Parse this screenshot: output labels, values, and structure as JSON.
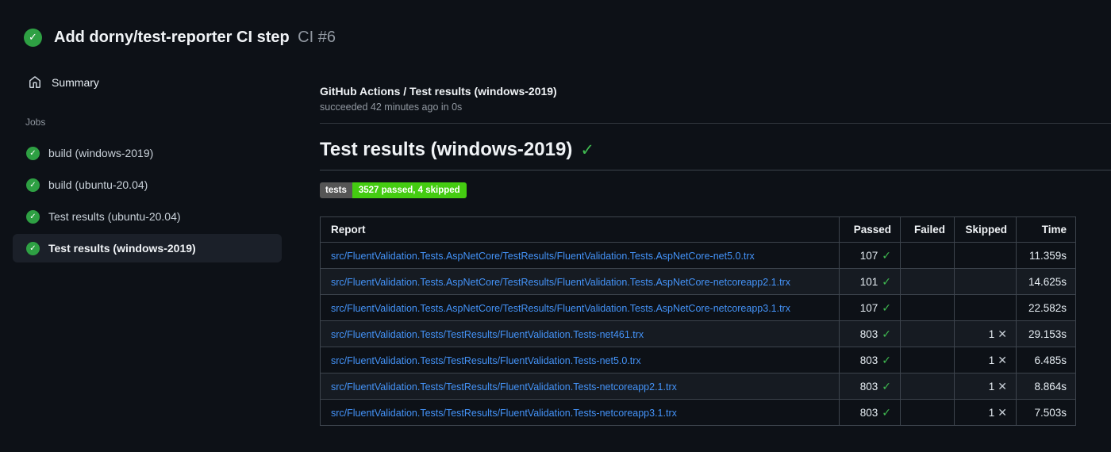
{
  "icons": {
    "check": "✓",
    "cross": "✕"
  },
  "colors": {
    "page_bg": "#0d1117",
    "row_alt_bg": "#161b22",
    "selected_item_bg": "#1b2029",
    "accent_green": "#2ea043",
    "check_green": "#3fb950",
    "link_blue": "#4493f8",
    "badge_gray": "#555555",
    "badge_green": "#44cc11",
    "border_gray": "#3d444d"
  },
  "header": {
    "title": "Add dorny/test-reporter CI step",
    "run_number": "CI #6"
  },
  "sidebar": {
    "summary_label": "Summary",
    "jobs_label": "Jobs",
    "jobs": [
      {
        "label": "build (windows-2019)",
        "selected": false
      },
      {
        "label": "build (ubuntu-20.04)",
        "selected": false
      },
      {
        "label": "Test results (ubuntu-20.04)",
        "selected": false
      },
      {
        "label": "Test results (windows-2019)",
        "selected": true
      }
    ]
  },
  "main": {
    "breadcrumb": "GitHub Actions / Test results (windows-2019)",
    "status_line": "succeeded 42 minutes ago in 0s",
    "heading": "Test results (windows-2019)",
    "badge": {
      "label": "tests",
      "value": "3527 passed, 4 skipped"
    },
    "table": {
      "columns": [
        {
          "key": "report",
          "label": "Report"
        },
        {
          "key": "passed",
          "label": "Passed"
        },
        {
          "key": "failed",
          "label": "Failed"
        },
        {
          "key": "skipped",
          "label": "Skipped"
        },
        {
          "key": "time",
          "label": "Time"
        }
      ],
      "rows": [
        {
          "report": "src/FluentValidation.Tests.AspNetCore/TestResults/FluentValidation.Tests.AspNetCore-net5.0.trx",
          "passed": "107",
          "failed": "",
          "skipped": "",
          "time": "11.359s"
        },
        {
          "report": "src/FluentValidation.Tests.AspNetCore/TestResults/FluentValidation.Tests.AspNetCore-netcoreapp2.1.trx",
          "passed": "101",
          "failed": "",
          "skipped": "",
          "time": "14.625s"
        },
        {
          "report": "src/FluentValidation.Tests.AspNetCore/TestResults/FluentValidation.Tests.AspNetCore-netcoreapp3.1.trx",
          "passed": "107",
          "failed": "",
          "skipped": "",
          "time": "22.582s"
        },
        {
          "report": "src/FluentValidation.Tests/TestResults/FluentValidation.Tests-net461.trx",
          "passed": "803",
          "failed": "",
          "skipped": "1",
          "time": "29.153s"
        },
        {
          "report": "src/FluentValidation.Tests/TestResults/FluentValidation.Tests-net5.0.trx",
          "passed": "803",
          "failed": "",
          "skipped": "1",
          "time": "6.485s"
        },
        {
          "report": "src/FluentValidation.Tests/TestResults/FluentValidation.Tests-netcoreapp2.1.trx",
          "passed": "803",
          "failed": "",
          "skipped": "1",
          "time": "8.864s"
        },
        {
          "report": "src/FluentValidation.Tests/TestResults/FluentValidation.Tests-netcoreapp3.1.trx",
          "passed": "803",
          "failed": "",
          "skipped": "1",
          "time": "7.503s"
        }
      ]
    }
  }
}
